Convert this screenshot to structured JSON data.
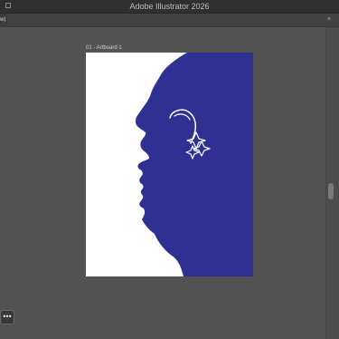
{
  "window": {
    "title": "Adobe Illustrator 2026"
  },
  "document": {
    "tab_label": "w)",
    "close_label": "×"
  },
  "artboard": {
    "label": "01 - Artboard 1",
    "background": "#ffffff",
    "silhouette_color": "#2e3192",
    "line_color": "#ffffff"
  },
  "controls": {
    "more_label": "•••"
  }
}
